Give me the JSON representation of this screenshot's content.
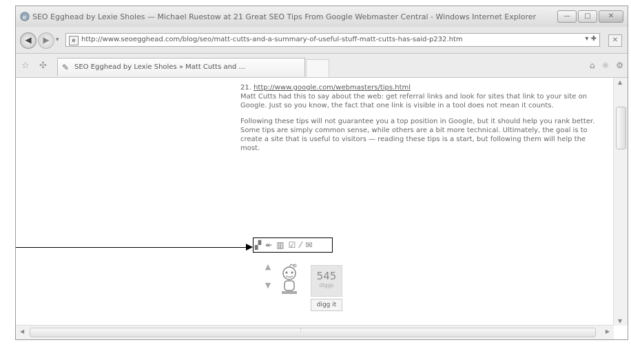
{
  "window": {
    "title": "SEO Egghead by Lexie Sholes — Michael Ruestow at 21 Great SEO Tips From Google Webmaster Central - Windows Internet Explorer",
    "buttons": {
      "minimize": "—",
      "maximize": "□",
      "close": "✕"
    }
  },
  "address": {
    "url": "http://www.seoegghead.com/blog/seo/matt-cutts-and-a-summary-of-useful-stuff-matt-cutts-has-said-p232.htm",
    "go_label": "▾ ✚",
    "refresh": "✕"
  },
  "tabs": [
    {
      "title": "SEO Egghead by Lexie Sholes » Matt Cutts and ..."
    }
  ],
  "command_bar": {
    "home": "⌂",
    "feeds": "☼",
    "print": "⚙"
  },
  "article": {
    "item_number": "21.",
    "item_link": "http://www.google.com/webmasters/tips.html",
    "item_text": "Matt Cutts had this to say about the web: get referral links and look for sites that link to your site on Google. Just so you know, the fact that one link is visible in a tool does not mean it counts.",
    "paragraph": "Following these tips will not guarantee you a top position in Google, but it should help you rank better. Some tips are simply common sense, while others are a bit more technical. Ultimately, the goal is to create a site that is useful to visitors — reading these tips is a start, but following them will help the most."
  },
  "share": {
    "icons": [
      "delicious-icon",
      "stumble-icon",
      "technorati-icon",
      "digg-small-icon",
      "reddit-small-icon",
      "email-icon"
    ]
  },
  "digg": {
    "count": "545",
    "count_label": "diggs",
    "button_label": "digg it"
  }
}
